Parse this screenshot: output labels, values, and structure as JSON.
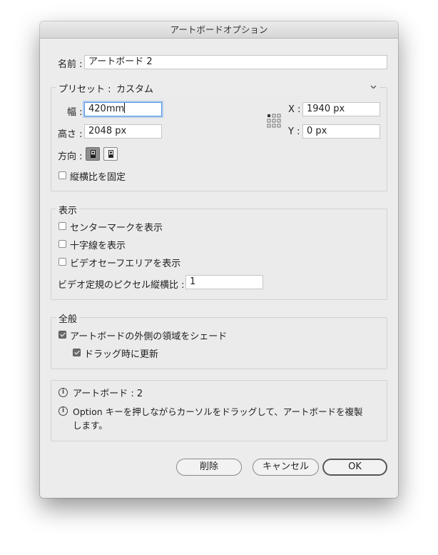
{
  "dialog": {
    "title": "アートボードオプション"
  },
  "name": {
    "label": "名前 :",
    "value": "アートボード 2"
  },
  "preset": {
    "legend": "プリセット :",
    "value": "カスタム",
    "width_label": "幅 :",
    "width_value": "420mm",
    "height_label": "高さ :",
    "height_value": "2048 px",
    "x_label": "X :",
    "x_value": "1940 px",
    "y_label": "Y :",
    "y_value": "0 px",
    "orientation_label": "方向 :",
    "lock_ratio_label": "縦横比を固定",
    "lock_ratio_checked": false
  },
  "display": {
    "legend": "表示",
    "center_mark_label": "センターマークを表示",
    "cross_hairs_label": "十字線を表示",
    "video_safe_label": "ビデオセーフエリアを表示",
    "pixel_ratio_label": "ビデオ定規のピクセル縦横比 :",
    "pixel_ratio_value": "1"
  },
  "global": {
    "legend": "全般",
    "fade_label": "アートボードの外側の領域をシェード",
    "fade_checked": true,
    "update_label": "ドラッグ時に更新",
    "update_checked": true
  },
  "info": {
    "artboards_text": "アートボード : 2",
    "hint_line1": "Option キーを押しながらカーソルをドラッグして、アートボードを複製",
    "hint_line2": "します。"
  },
  "buttons": {
    "delete": "削除",
    "cancel": "キャンセル",
    "ok": "OK"
  },
  "icons": {
    "chevron": "chevron-down-icon",
    "reference_point": "reference-point-icon",
    "info": "info-icon",
    "portrait": "portrait-orientation-icon",
    "landscape": "landscape-orientation-icon"
  }
}
